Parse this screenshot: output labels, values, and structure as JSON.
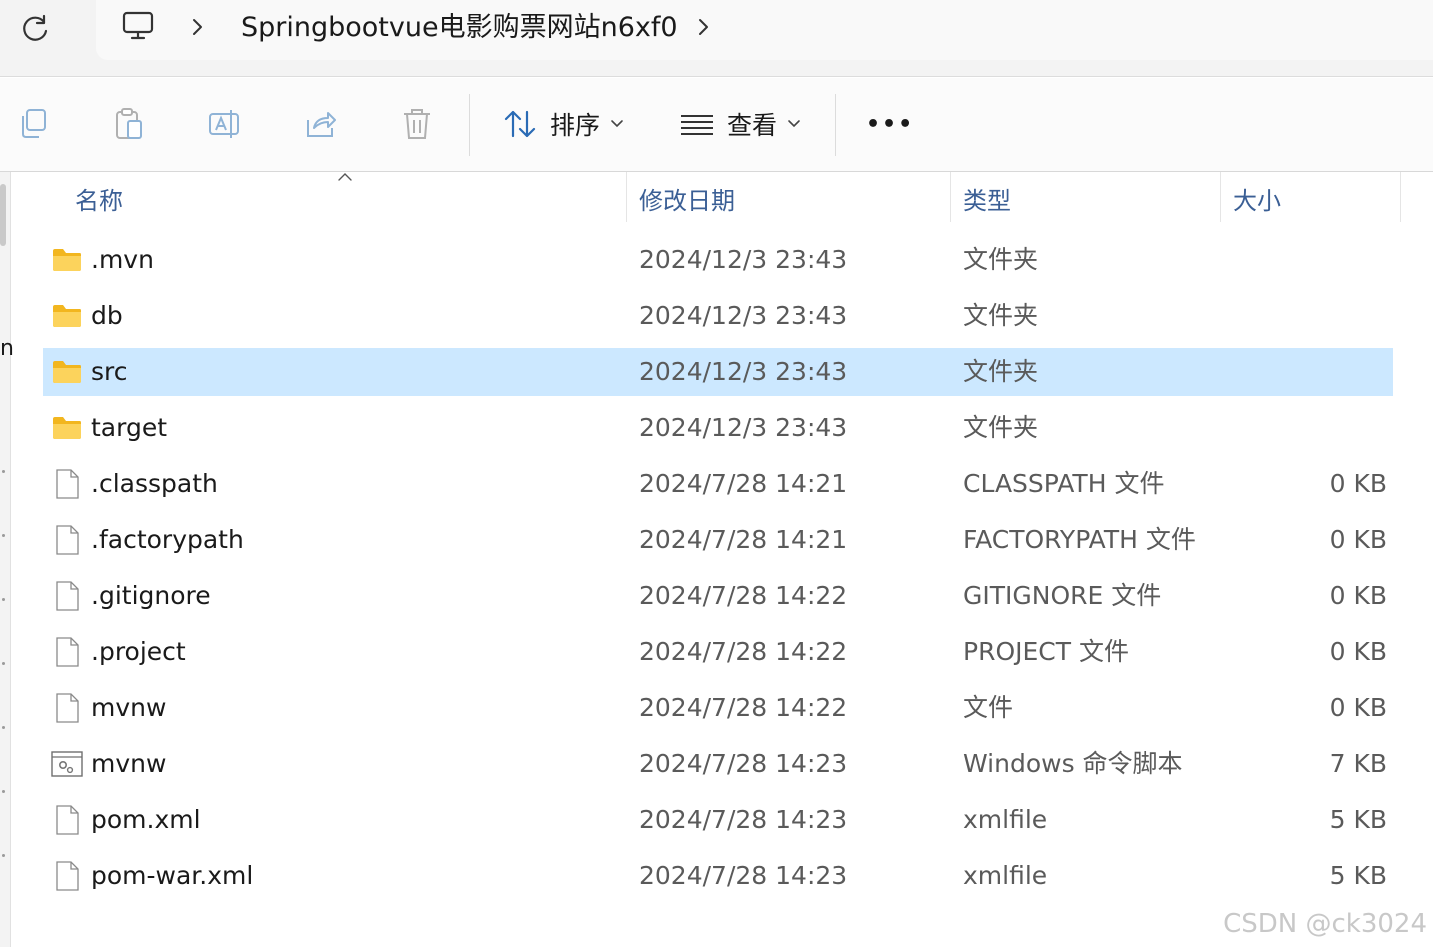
{
  "address_bar": {
    "crumb": "Springbootvue电影购票网站n6xf0"
  },
  "toolbar": {
    "sort_label": "排序",
    "view_label": "查看",
    "more_label": "•••"
  },
  "columns": {
    "name": "名称",
    "date": "修改日期",
    "type": "类型",
    "size": "大小"
  },
  "left_pane": {
    "glyph": "n"
  },
  "files": [
    {
      "name": ".mvn",
      "date": "2024/12/3 23:43",
      "type": "文件夹",
      "size": "",
      "icon": "folder-icon",
      "selected": false
    },
    {
      "name": "db",
      "date": "2024/12/3 23:43",
      "type": "文件夹",
      "size": "",
      "icon": "folder-icon",
      "selected": false
    },
    {
      "name": "src",
      "date": "2024/12/3 23:43",
      "type": "文件夹",
      "size": "",
      "icon": "folder-icon",
      "selected": true
    },
    {
      "name": "target",
      "date": "2024/12/3 23:43",
      "type": "文件夹",
      "size": "",
      "icon": "folder-icon",
      "selected": false
    },
    {
      "name": ".classpath",
      "date": "2024/7/28 14:21",
      "type": "CLASSPATH 文件",
      "size": "0 KB",
      "icon": "file-icon",
      "selected": false
    },
    {
      "name": ".factorypath",
      "date": "2024/7/28 14:21",
      "type": "FACTORYPATH 文件",
      "size": "0 KB",
      "icon": "file-icon",
      "selected": false
    },
    {
      "name": ".gitignore",
      "date": "2024/7/28 14:22",
      "type": "GITIGNORE 文件",
      "size": "0 KB",
      "icon": "file-icon",
      "selected": false
    },
    {
      "name": ".project",
      "date": "2024/7/28 14:22",
      "type": "PROJECT 文件",
      "size": "0 KB",
      "icon": "file-icon",
      "selected": false
    },
    {
      "name": "mvnw",
      "date": "2024/7/28 14:22",
      "type": "文件",
      "size": "0 KB",
      "icon": "file-icon",
      "selected": false
    },
    {
      "name": "mvnw",
      "date": "2024/7/28 14:23",
      "type": "Windows 命令脚本",
      "size": "7 KB",
      "icon": "script-icon",
      "selected": false
    },
    {
      "name": "pom.xml",
      "date": "2024/7/28 14:23",
      "type": "xmlfile",
      "size": "5 KB",
      "icon": "file-icon",
      "selected": false
    },
    {
      "name": "pom-war.xml",
      "date": "2024/7/28 14:23",
      "type": "xmlfile",
      "size": "5 KB",
      "icon": "file-icon",
      "selected": false
    }
  ],
  "watermark": "CSDN @ck3024",
  "colors": {
    "selected_row": "#cce8ff",
    "folder": "#f7c948",
    "header_text": "#3b5f95"
  }
}
